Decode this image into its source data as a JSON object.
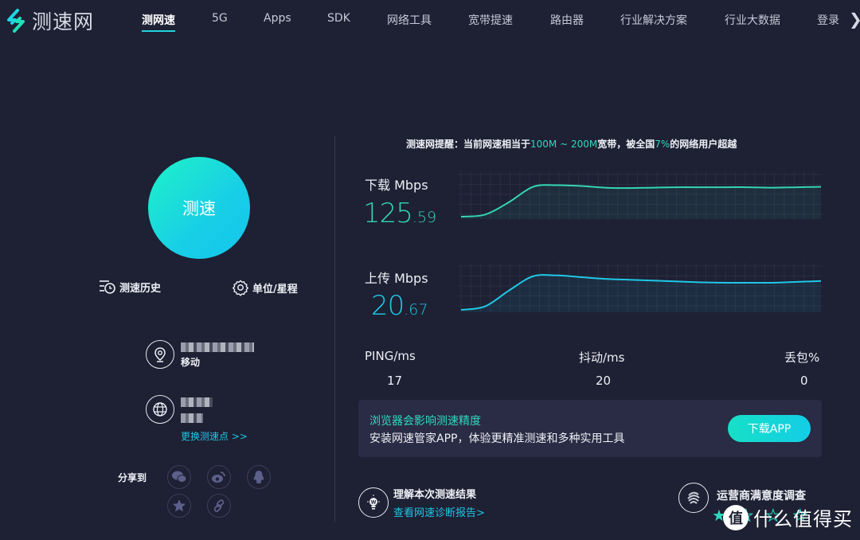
{
  "header": {
    "logo_text": "测速网",
    "nav": [
      {
        "label": "测网速",
        "active": true
      },
      {
        "label": "5G"
      },
      {
        "label": "Apps"
      },
      {
        "label": "SDK"
      },
      {
        "label": "网络工具"
      },
      {
        "label": "宽带提速"
      },
      {
        "label": "路由器"
      },
      {
        "label": "行业解决方案"
      },
      {
        "label": "行业大数据"
      },
      {
        "label": "登录"
      }
    ],
    "close_glyph": "❯"
  },
  "left": {
    "start_label": "测速",
    "history_label": "测速历史",
    "settings_label": "单位/星程",
    "location": {
      "isp": "移动"
    },
    "change_node_label": "更换测速点 >>",
    "share_label": "分享到",
    "share_icons": [
      "wechat-icon",
      "weibo-icon",
      "qq-icon",
      "qzone-icon",
      "link-icon"
    ]
  },
  "right": {
    "tip": {
      "prefix": "测速网提醒：当前网速相当于",
      "range": "100M ~ 200M",
      "middle": "宽带，被全国",
      "percent": "7%",
      "suffix": "的网络用户超越"
    },
    "download": {
      "label": "下载 Mbps",
      "int": "125",
      "dec": ".59",
      "color": "#33d6b0"
    },
    "upload": {
      "label": "上传 Mbps",
      "int": "20",
      "dec": ".67",
      "color": "#1ec8e6"
    },
    "stats": [
      {
        "label": "PING/ms",
        "value": "17"
      },
      {
        "label": "抖动/ms",
        "value": "20"
      },
      {
        "label": "丢包%",
        "value": "0"
      }
    ],
    "promo": {
      "title": "浏览器会影响测速精度",
      "desc": "安装网速管家APP，体验更精准测速和多种实用工具",
      "button": "下载APP"
    },
    "understand": {
      "title": "理解本次测速结果",
      "link": "查看网速诊断报告>"
    },
    "survey": {
      "title": "运营商满意度调查"
    }
  },
  "watermark": {
    "badge": "值",
    "text": "什么值得买"
  },
  "chart_data": [
    {
      "type": "line",
      "title": "下载 Mbps",
      "series": [
        {
          "name": "download",
          "values": [
            0.0,
            0.05,
            0.35,
            0.72,
            0.76,
            0.74,
            0.7,
            0.69,
            0.7,
            0.71,
            0.71,
            0.71,
            0.71,
            0.7,
            0.71,
            0.72
          ]
        }
      ],
      "ylim": [
        0,
        1
      ],
      "grid": true
    },
    {
      "type": "line",
      "title": "上传 Mbps",
      "series": [
        {
          "name": "upload",
          "values": [
            0.0,
            0.08,
            0.45,
            0.78,
            0.8,
            0.76,
            0.72,
            0.7,
            0.68,
            0.66,
            0.64,
            0.63,
            0.63,
            0.63,
            0.65,
            0.67
          ]
        }
      ],
      "ylim": [
        0,
        1
      ],
      "grid": true
    }
  ]
}
